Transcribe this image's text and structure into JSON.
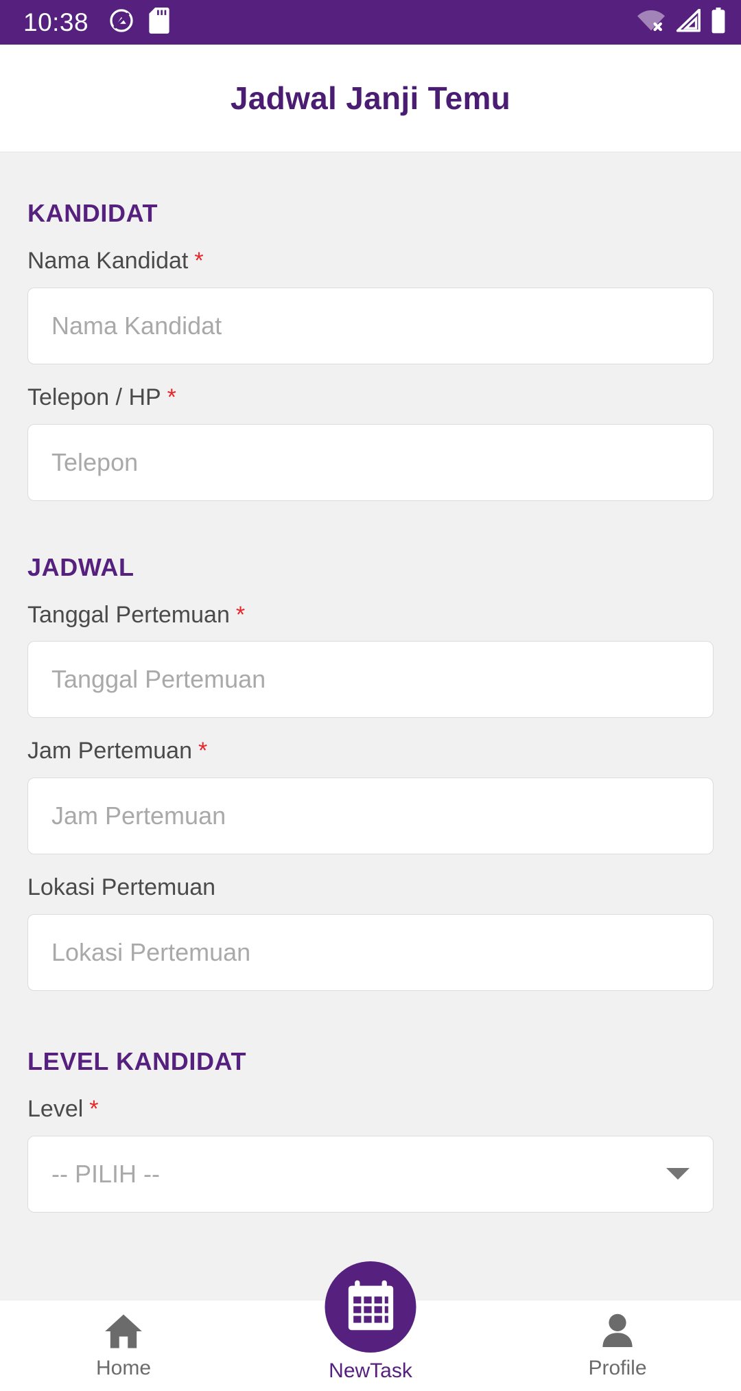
{
  "status_bar": {
    "time": "10:38",
    "background_color": "#56207e",
    "left_icons": [
      {
        "name": "do-not-disturb-icon"
      },
      {
        "name": "sd-card-icon"
      }
    ],
    "right_icons": [
      {
        "name": "wifi-off-icon"
      },
      {
        "name": "cellular-signal-icon"
      },
      {
        "name": "battery-full-icon"
      }
    ]
  },
  "app_bar": {
    "title": "Jadwal Janji Temu",
    "title_color": "#4a1d72"
  },
  "theme": {
    "accent": "#56207e",
    "required_marker_color": "#e8252a",
    "page_background": "#f1f1f1",
    "placeholder_color": "#a9a9a9"
  },
  "form": {
    "required_marker": "*",
    "sections": [
      {
        "heading": "KANDIDAT",
        "fields": [
          {
            "label": "Nama Kandidat",
            "required": true,
            "placeholder": "Nama Kandidat",
            "value": "",
            "type": "text"
          },
          {
            "label": "Telepon / HP",
            "required": true,
            "placeholder": "Telepon",
            "value": "",
            "type": "text"
          }
        ]
      },
      {
        "heading": "JADWAL",
        "fields": [
          {
            "label": "Tanggal Pertemuan",
            "required": true,
            "placeholder": "Tanggal Pertemuan",
            "value": "",
            "type": "date"
          },
          {
            "label": "Jam Pertemuan",
            "required": true,
            "placeholder": "Jam Pertemuan",
            "value": "",
            "type": "time"
          },
          {
            "label": "Lokasi Pertemuan",
            "required": false,
            "placeholder": "Lokasi Pertemuan",
            "value": "",
            "type": "text"
          }
        ]
      },
      {
        "heading": "LEVEL KANDIDAT",
        "fields": [
          {
            "label": "Level",
            "required": true,
            "placeholder": "-- PILIH --",
            "value": "-- PILIH --",
            "type": "select"
          }
        ]
      }
    ]
  },
  "bottom_nav": {
    "items": [
      {
        "label": "Home",
        "icon": "home-icon",
        "active": false
      },
      {
        "label": "NewTask",
        "icon": "calendar-icon",
        "active": true
      },
      {
        "label": "Profile",
        "icon": "person-icon",
        "active": false
      }
    ]
  }
}
